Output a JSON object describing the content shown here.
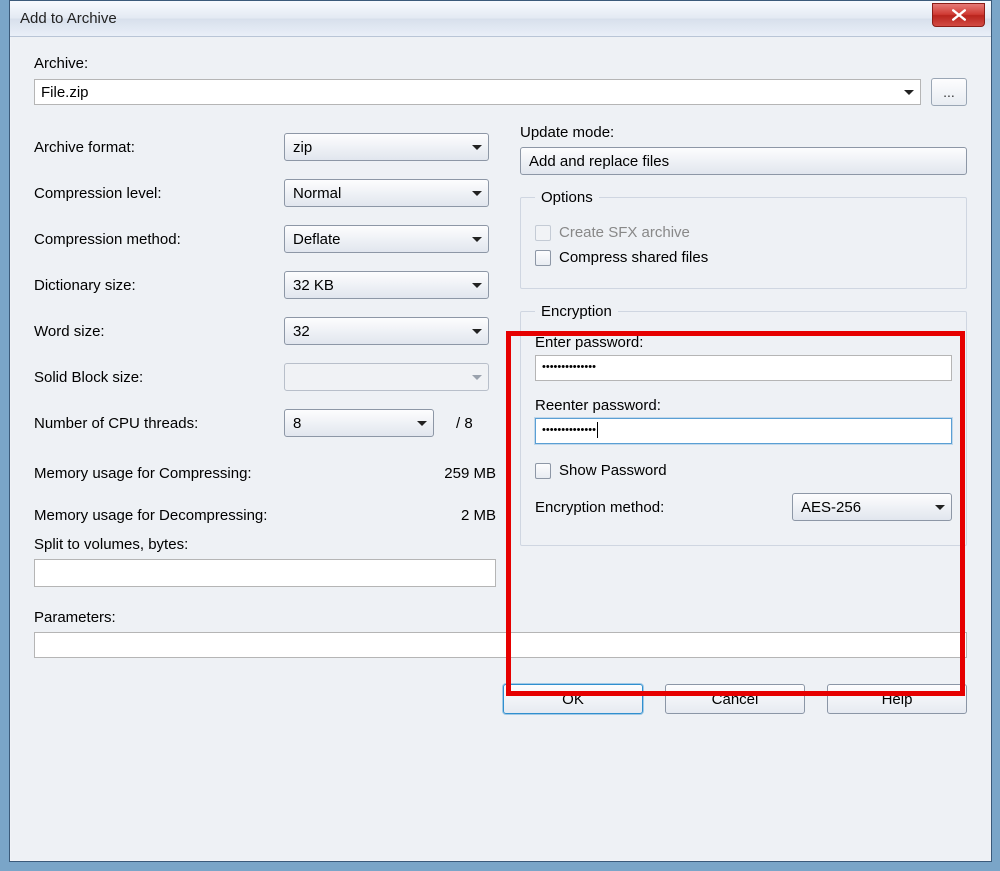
{
  "window": {
    "title": "Add to Archive"
  },
  "archive": {
    "label": "Archive:",
    "value": "File.zip",
    "browse_label": "..."
  },
  "left": {
    "format_label": "Archive format:",
    "format_value": "zip",
    "level_label": "Compression level:",
    "level_value": "Normal",
    "method_label": "Compression method:",
    "method_value": "Deflate",
    "dict_label": "Dictionary size:",
    "dict_value": "32 KB",
    "word_label": "Word size:",
    "word_value": "32",
    "solid_label": "Solid Block size:",
    "solid_value": "",
    "threads_label": "Number of CPU threads:",
    "threads_value": "8",
    "threads_max": "/ 8",
    "mem_comp_label": "Memory usage for Compressing:",
    "mem_comp_value": "259 MB",
    "mem_decomp_label": "Memory usage for Decompressing:",
    "mem_decomp_value": "2 MB",
    "split_label": "Split to volumes, bytes:",
    "split_value": ""
  },
  "right": {
    "update_label": "Update mode:",
    "update_value": "Add and replace files",
    "options_legend": "Options",
    "opt_sfx": "Create SFX archive",
    "opt_shared": "Compress shared files",
    "enc_legend": "Encryption",
    "enter_pwd_label": "Enter password:",
    "enter_pwd_value": "••••••••••••••",
    "reenter_pwd_label": "Reenter password:",
    "reenter_pwd_value": "••••••••••••••",
    "show_pwd": "Show Password",
    "enc_method_label": "Encryption method:",
    "enc_method_value": "AES-256"
  },
  "params": {
    "label": "Parameters:",
    "value": ""
  },
  "buttons": {
    "ok": "OK",
    "cancel": "Cancel",
    "help": "Help"
  }
}
